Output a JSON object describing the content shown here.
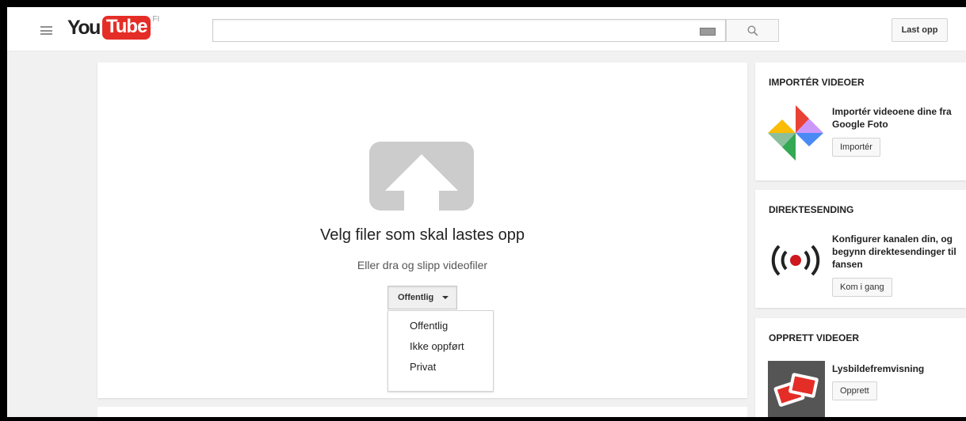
{
  "header": {
    "logo_you": "You",
    "logo_tube": "Tube",
    "logo_country": "FI",
    "search_placeholder": "",
    "upload_label": "Last opp"
  },
  "upload": {
    "title": "Velg filer som skal lastes opp",
    "subtitle": "Eller dra og slipp videofiler",
    "privacy_selected": "Offentlig",
    "privacy_options": [
      "Offentlig",
      "Ikke oppført",
      "Privat"
    ]
  },
  "sidebar": {
    "import": {
      "heading": "IMPORTÉR VIDEOER",
      "text": "Importér videoene dine fra Google Foto",
      "button": "Importér"
    },
    "live": {
      "heading": "DIREKTESENDING",
      "text": "Konfigurer kanalen din, og begynn direktesendinger til fansen",
      "button": "Kom i gang"
    },
    "create": {
      "heading": "OPPRETT VIDEOER",
      "text": "Lysbildefremvisning",
      "button": "Opprett"
    }
  },
  "icons": {
    "menu": "hamburger-menu-icon",
    "keyboard": "keyboard-icon",
    "search": "search-icon",
    "upload": "upload-arrow-icon",
    "photos": "google-photos-pinwheel-icon",
    "live": "broadcast-icon",
    "slideshow": "slideshow-icon"
  },
  "colors": {
    "brand_red": "#e52d27",
    "upload_icon_gray": "#cccccc",
    "live_red": "#cc181e"
  }
}
